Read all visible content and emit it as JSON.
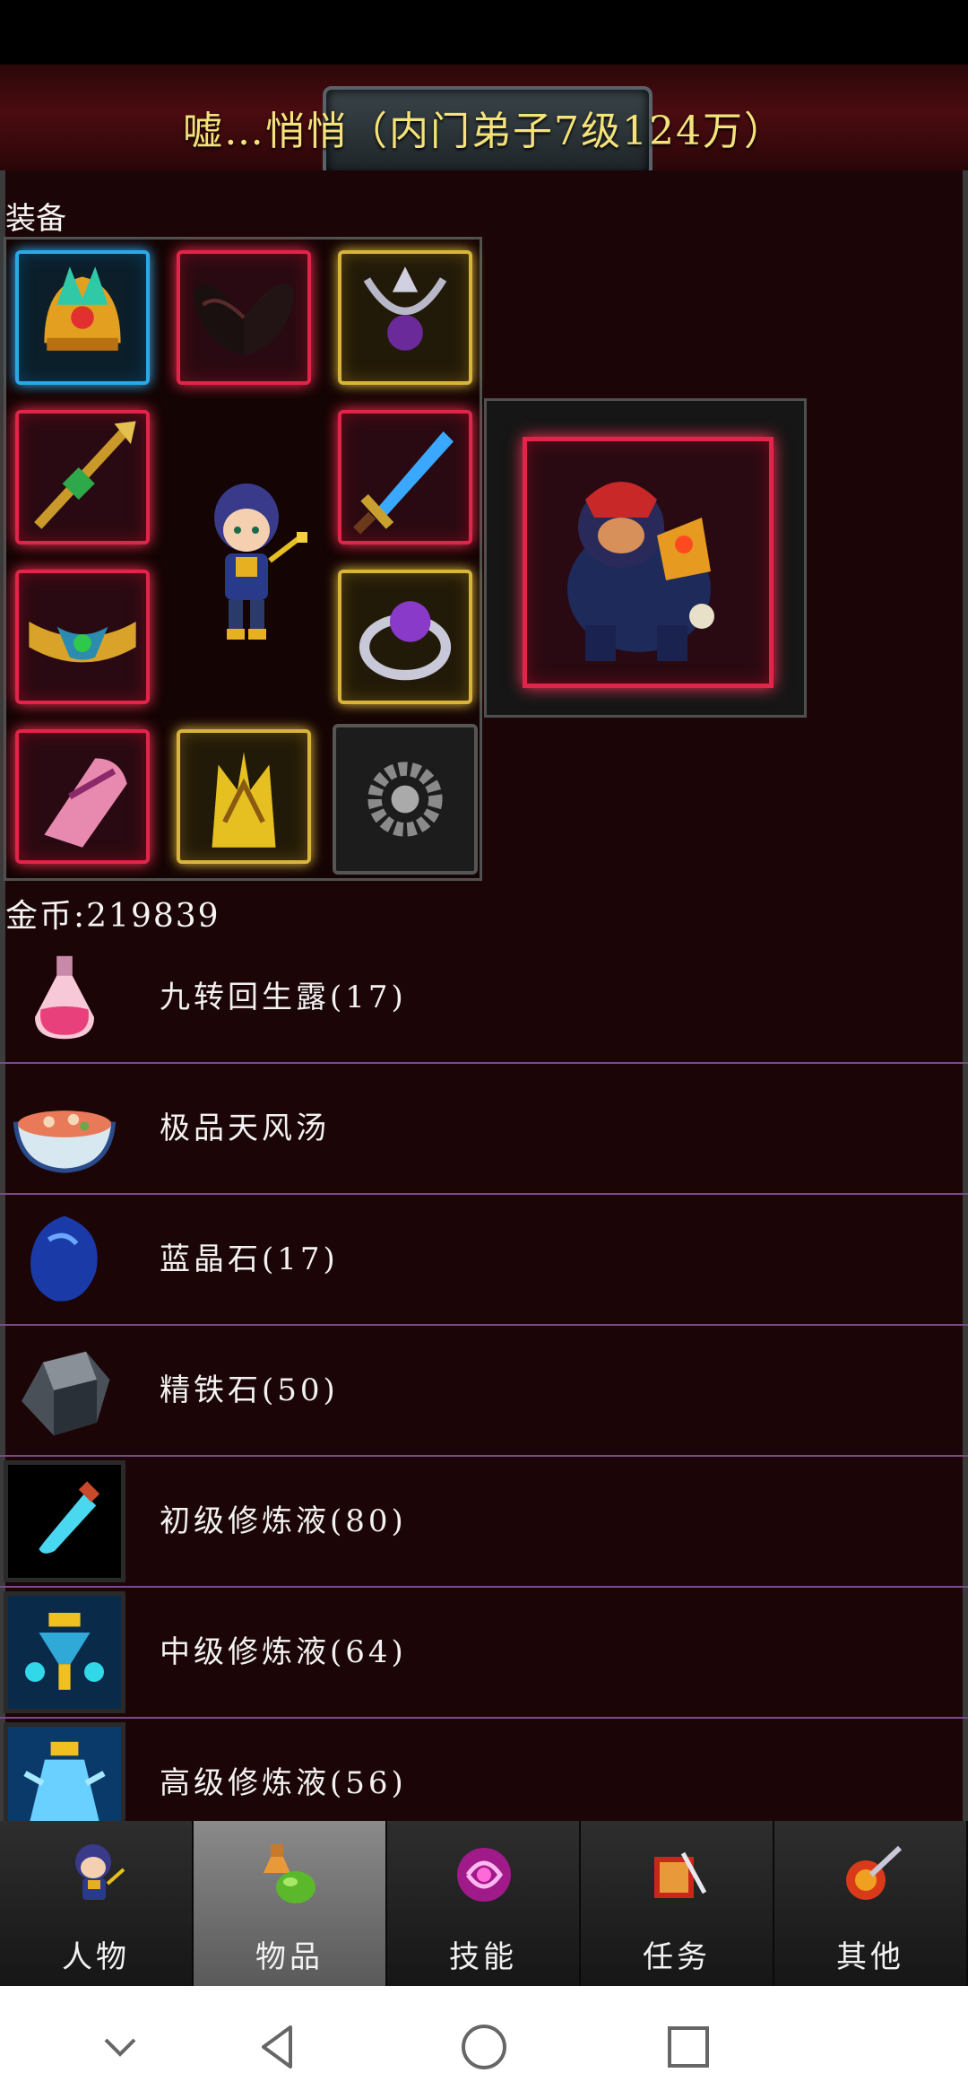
{
  "header": {
    "title": "嘘…悄悄（内门弟子7级124万）"
  },
  "equipment": {
    "label": "装备",
    "slots": [
      {
        "icon": "helmet-icon",
        "rarity": "blue"
      },
      {
        "icon": "wings-icon",
        "rarity": "red"
      },
      {
        "icon": "necklace-icon",
        "rarity": "gold"
      },
      {
        "icon": "staff-icon",
        "rarity": "red"
      },
      {
        "icon": "sword-icon",
        "rarity": "red"
      },
      {
        "icon": "belt-icon",
        "rarity": "red"
      },
      {
        "icon": "ring-icon",
        "rarity": "gold"
      },
      {
        "icon": "boots-icon",
        "rarity": "red"
      },
      {
        "icon": "armor-icon",
        "rarity": "gold"
      },
      {
        "icon": "beads-icon",
        "rarity": "gray"
      }
    ],
    "avatar": "character-avatar",
    "pet": "pet-beast"
  },
  "gold": {
    "text": "金币:219839"
  },
  "items": [
    {
      "icon": "potion-icon",
      "name": "九转回生露(17)"
    },
    {
      "icon": "soup-icon",
      "name": "极品天风汤"
    },
    {
      "icon": "blue-crystal-icon",
      "name": "蓝晶石(17)"
    },
    {
      "icon": "iron-ore-icon",
      "name": "精铁石(50)"
    },
    {
      "icon": "vial-icon",
      "name": "初级修炼液(80)"
    },
    {
      "icon": "flask-icon",
      "name": "中级修炼液(64)"
    },
    {
      "icon": "lamp-icon",
      "name": "高级修炼液(56)"
    }
  ],
  "tabs": [
    {
      "label": "人物",
      "icon": "character-icon"
    },
    {
      "label": "物品",
      "icon": "items-icon",
      "active": true
    },
    {
      "label": "技能",
      "icon": "skills-icon"
    },
    {
      "label": "任务",
      "icon": "quest-icon"
    },
    {
      "label": "其他",
      "icon": "other-icon"
    }
  ],
  "colors": {
    "rarity_red": "#e0244a",
    "rarity_gold": "#d8b43a",
    "rarity_blue": "#2aa8e8",
    "title": "#f5e27a",
    "divider": "#7a4a8c"
  }
}
